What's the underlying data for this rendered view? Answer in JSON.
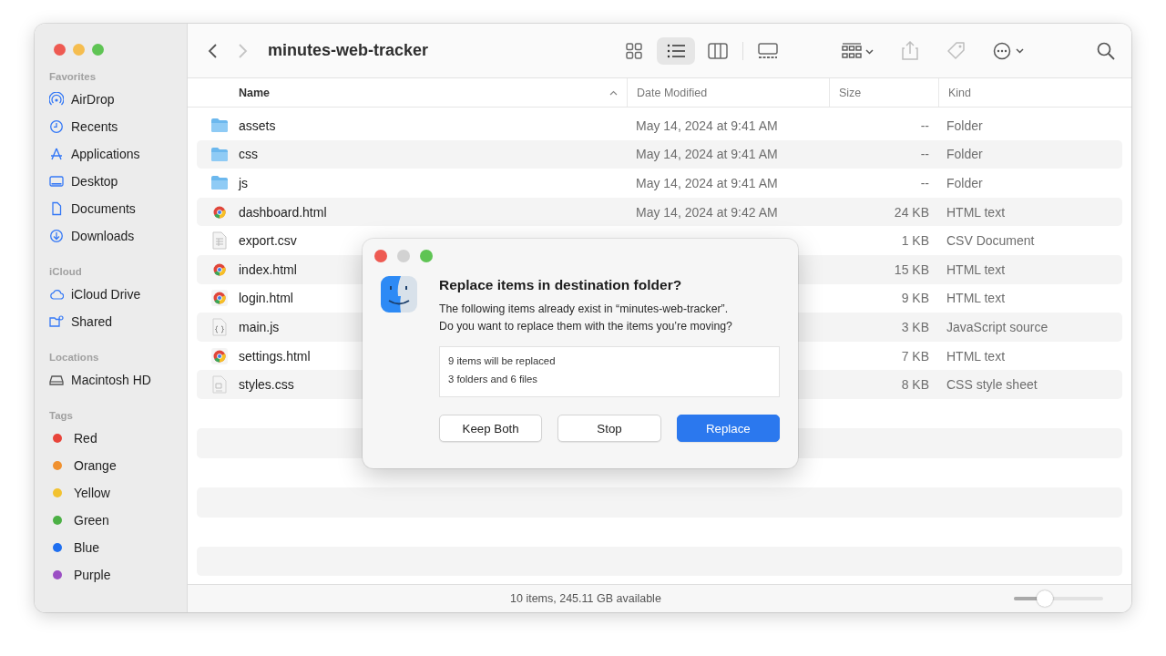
{
  "window": {
    "title": "minutes-web-tracker",
    "controls": [
      {
        "kind": "close",
        "disabled": false
      },
      {
        "kind": "minimize",
        "disabled": false
      },
      {
        "kind": "zoom",
        "disabled": false
      }
    ],
    "nav": [
      {
        "kind": "back",
        "disabled": false
      },
      {
        "kind": "forward",
        "disabled": true
      }
    ]
  },
  "toolbar": {
    "views": [
      {
        "kind": "icons",
        "selected": false
      },
      {
        "kind": "list",
        "selected": true
      },
      {
        "kind": "columns",
        "selected": false
      },
      {
        "kind": "gallery",
        "selected": false
      }
    ],
    "tools": [
      {
        "kind": "group",
        "disabled": false
      },
      {
        "kind": "share",
        "disabled": true
      },
      {
        "kind": "tag",
        "disabled": true
      },
      {
        "kind": "more",
        "disabled": false
      },
      {
        "kind": "search",
        "disabled": false
      }
    ]
  },
  "sidebar": {
    "sections": [
      {
        "title": "Favorites",
        "items": [
          {
            "label": "AirDrop"
          },
          {
            "label": "Recents"
          },
          {
            "label": "Applications"
          },
          {
            "label": "Desktop"
          },
          {
            "label": "Documents"
          },
          {
            "label": "Downloads"
          }
        ]
      },
      {
        "title": "iCloud",
        "items": [
          {
            "label": "iCloud Drive"
          },
          {
            "label": "Shared"
          }
        ]
      },
      {
        "title": "Locations",
        "items": [
          {
            "label": "Macintosh HD"
          }
        ]
      },
      {
        "title": "Tags",
        "items": [
          {
            "label": "Red",
            "color": "#e8443a"
          },
          {
            "label": "Orange",
            "color": "#f0912f"
          },
          {
            "label": "Yellow",
            "color": "#f2c230"
          },
          {
            "label": "Green",
            "color": "#4cb045"
          },
          {
            "label": "Blue",
            "color": "#1f6ff0"
          },
          {
            "label": "Purple",
            "color": "#9b4fc4"
          }
        ]
      }
    ]
  },
  "table": {
    "columns": [
      {
        "label": "Name",
        "sorted": true
      },
      {
        "label": "Date Modified",
        "sorted": false
      },
      {
        "label": "Size",
        "sorted": false
      },
      {
        "label": "Kind",
        "sorted": false
      }
    ],
    "rows": [
      {
        "kind": "folder",
        "name": "assets",
        "date_modified": "May 14, 2024 at 9:41 AM",
        "size": "--",
        "file_kind": "Folder"
      },
      {
        "kind": "folder",
        "name": "css",
        "date_modified": "May 14, 2024 at 9:41 AM",
        "size": "--",
        "file_kind": "Folder"
      },
      {
        "kind": "folder",
        "name": "js",
        "date_modified": "May 14, 2024 at 9:41 AM",
        "size": "--",
        "file_kind": "Folder"
      },
      {
        "kind": "web",
        "name": "dashboard.html",
        "date_modified": "May 14, 2024 at 9:42 AM",
        "size": "24 KB",
        "file_kind": "HTML text"
      },
      {
        "kind": "csv",
        "name": "export.csv",
        "size": "1 KB",
        "file_kind": "CSV Document"
      },
      {
        "kind": "web",
        "name": "index.html",
        "size": "15 KB",
        "file_kind": "HTML text"
      },
      {
        "kind": "web",
        "name": "login.html",
        "size": "9 KB",
        "file_kind": "HTML text"
      },
      {
        "kind": "script",
        "name": "main.js",
        "size": "3 KB",
        "file_kind": "JavaScript source"
      },
      {
        "kind": "web",
        "name": "settings.html",
        "size": "7 KB",
        "file_kind": "HTML text"
      },
      {
        "kind": "css",
        "name": "styles.css",
        "size": "8 KB",
        "file_kind": "CSS style sheet"
      }
    ]
  },
  "status_bar": {
    "text": "10 items, 245.11 GB available",
    "zoom_slider": {
      "level": 0.35
    }
  },
  "dialog": {
    "controls": [
      {
        "kind": "close",
        "disabled": false
      },
      {
        "kind": "minimize",
        "disabled": true
      },
      {
        "kind": "zoom",
        "disabled": false
      }
    ],
    "title": "Replace items in destination folder?",
    "message": [
      "The following items already exist in “minutes-web-tracker”.",
      "Do you want to replace them with the items you’re moving?"
    ],
    "details": [
      "9 items will be replaced",
      "3 folders and 6 files"
    ],
    "buttons": [
      {
        "label": "Keep Both",
        "default": false
      },
      {
        "label": "Stop",
        "default": false
      },
      {
        "label": "Replace",
        "default": true
      }
    ]
  }
}
